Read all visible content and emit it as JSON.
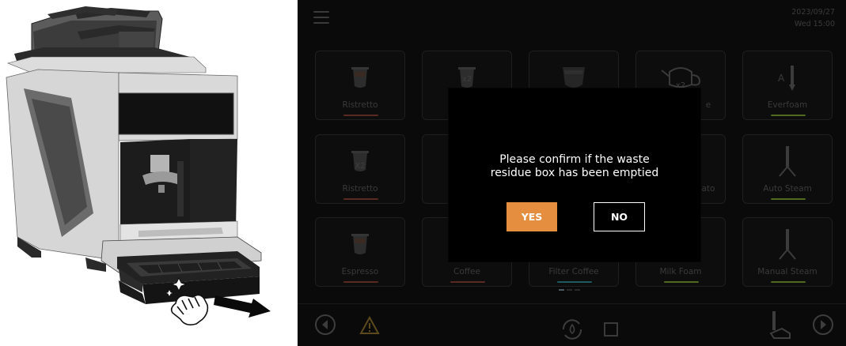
{
  "header": {
    "menu_icon": "hamburger-menu-icon",
    "date": "2023/09/27",
    "weekday_time": "Wed 15:00"
  },
  "tiles": [
    {
      "label": "Ristretto",
      "icon": "espresso-cup-icon",
      "bar_color": "#5a2a22"
    },
    {
      "label": "",
      "icon": "double-espresso-cup-icon",
      "bar_color": ""
    },
    {
      "label": "",
      "icon": "coffee-cup-icon",
      "bar_color": ""
    },
    {
      "label": "e",
      "icon": "double-teapot-icon",
      "bar_color": ""
    },
    {
      "label": "Everfoam",
      "icon": "foam-wand-icon",
      "bar_color": "#4f6a1f"
    },
    {
      "label": "Ristretto",
      "icon": "double-espresso-cup-icon",
      "bar_color": "#5a2a22"
    },
    {
      "label": "",
      "icon": "",
      "bar_color": ""
    },
    {
      "label": "",
      "icon": "",
      "bar_color": ""
    },
    {
      "label": "ato",
      "icon": "",
      "bar_color": ""
    },
    {
      "label": "Auto Steam",
      "icon": "steam-wand-icon",
      "bar_color": "#4f6a1f"
    },
    {
      "label": "Espresso",
      "icon": "espresso-cup-icon",
      "bar_color": "#5a2a22"
    },
    {
      "label": "Coffee",
      "icon": "",
      "bar_color": "#5a2a22"
    },
    {
      "label": "Filter Coffee",
      "icon": "",
      "bar_color": "#1f5a60"
    },
    {
      "label": "Milk Foam",
      "icon": "",
      "bar_color": "#4f6a1f"
    },
    {
      "label": "Manual Steam",
      "icon": "steam-wand-icon",
      "bar_color": "#4f6a1f"
    }
  ],
  "dialog": {
    "message_line1": "Please confirm if the waste",
    "message_line2": "residue box has been emptied",
    "yes_label": "YES",
    "no_label": "NO",
    "yes_color": "#e58e3f"
  },
  "bottom_bar": {
    "prev_icon": "chevron-left-icon",
    "warning_icon": "warning-triangle-icon",
    "rinse_icon": "water-drop-cycle-icon",
    "stop_icon": "stop-square-icon",
    "service_icon": "service-hand-icon",
    "next_icon": "chevron-right-icon"
  },
  "illustration": {
    "subject": "coffee-machine-with-drawer",
    "arrow_icon": "pull-arrow-icon",
    "hand_icon": "hand-icon"
  }
}
